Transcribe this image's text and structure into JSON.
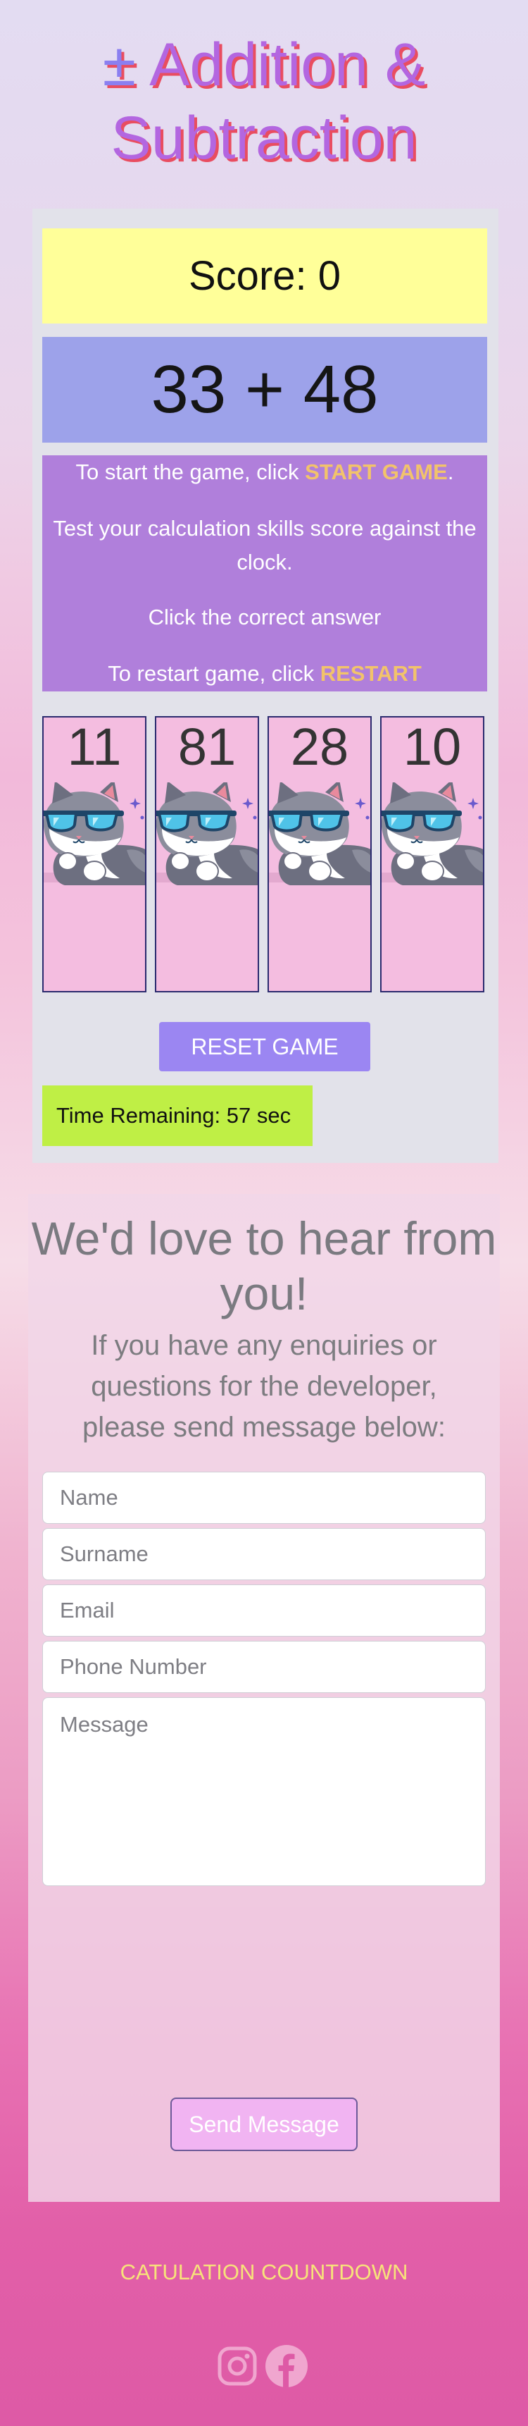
{
  "header": {
    "symbol": "±",
    "title_line1": "Addition &",
    "title_line2": "Subtraction"
  },
  "game": {
    "score_text": "Score: 0",
    "question": "33 + 48",
    "instructions": {
      "start_prefix": "To start the game, click ",
      "start_highlight": "START GAME",
      "start_suffix": ".",
      "test_line": "Test your calculation skills score against the clock.",
      "click_line": "Click the correct answer",
      "restart_prefix": "To restart game, click ",
      "restart_highlight": "RESTART"
    },
    "answers": [
      "11",
      "81",
      "28",
      "10"
    ],
    "card_icon": "cool-cat-sunglasses",
    "reset_label": "RESET GAME",
    "timer_text": "Time Remaining: 57 sec"
  },
  "contact": {
    "heading": "We'd love to hear from you!",
    "subheading": "If you have any enquiries or questions for the developer, please send message below:",
    "fields": {
      "name_placeholder": "Name",
      "surname_placeholder": "Surname",
      "email_placeholder": "Email",
      "phone_placeholder": "Phone Number",
      "message_placeholder": "Message"
    },
    "send_label": "Send Message"
  },
  "footer": {
    "title": "CATULATION COUNTDOWN",
    "social_icons": [
      "instagram-icon",
      "facebook-icon"
    ]
  },
  "colors": {
    "score_bg": "#ffff99",
    "question_bg": "#9da2ea",
    "instructions_bg": "#b07fdb",
    "highlight": "#f2c36b",
    "card_bg": "#f4bde0",
    "reset_bg": "#9b86f2",
    "timer_bg": "#bfef45",
    "send_bg": "#f1b4f2",
    "footer_text": "#f7e37a"
  }
}
